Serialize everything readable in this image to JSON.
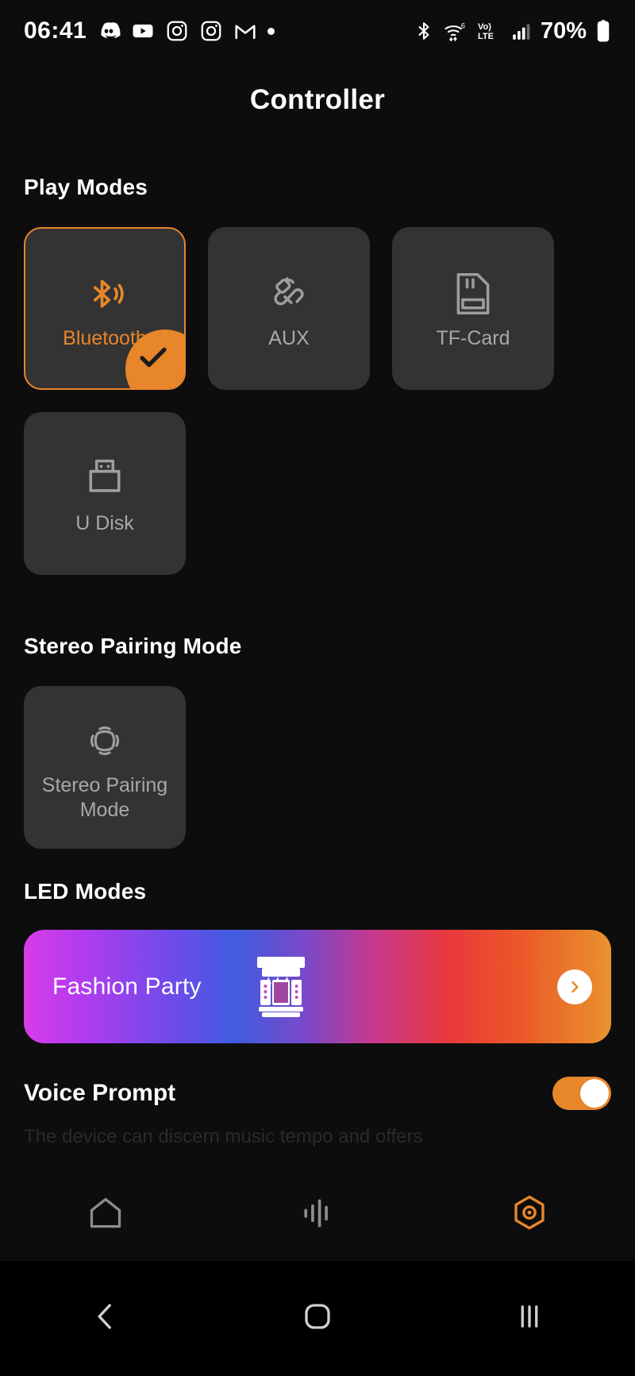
{
  "status_bar": {
    "time": "06:41",
    "left_icons": [
      "discord-icon",
      "youtube-icon",
      "instagram-icon",
      "instagram-icon",
      "gmail-icon",
      "notification-dot"
    ],
    "right_icons": [
      "bluetooth-icon",
      "wifi-6-icon",
      "volte-icon",
      "cellular-signal-icon"
    ],
    "battery_percent": "70%"
  },
  "header": {
    "title": "Controller"
  },
  "play_modes": {
    "section_label": "Play Modes",
    "cards": [
      {
        "label": "Bluetooth",
        "icon": "bluetooth-icon",
        "selected": true
      },
      {
        "label": "AUX",
        "icon": "aux-plug-icon",
        "selected": false
      },
      {
        "label": "TF-Card",
        "icon": "sd-card-icon",
        "selected": false
      },
      {
        "label": "U Disk",
        "icon": "usb-drive-icon",
        "selected": false
      }
    ],
    "selected_badge_icon": "check-icon"
  },
  "stereo_pairing": {
    "section_label": "Stereo Pairing Mode",
    "cards": [
      {
        "label": "Stereo Pairing Mode",
        "icon": "stereo-waves-icon",
        "selected": false
      }
    ]
  },
  "led_modes": {
    "section_label": "LED Modes",
    "current_mode": "Fashion Party",
    "mode_icon": "stage-lights-icon",
    "arrow_icon": "chevron-right-icon"
  },
  "voice_prompt": {
    "label": "Voice Prompt",
    "enabled": true,
    "description": "The device can discern music tempo and offers"
  },
  "tab_bar": {
    "items": [
      {
        "name": "home",
        "icon": "home-icon",
        "active": false
      },
      {
        "name": "equalizer",
        "icon": "waveform-icon",
        "active": false
      },
      {
        "name": "controller",
        "icon": "hexagon-target-icon",
        "active": true
      }
    ],
    "active_color": "#e8862a"
  },
  "android_nav": {
    "buttons": [
      {
        "name": "back",
        "icon": "back-chevron-icon"
      },
      {
        "name": "home",
        "icon": "home-square-icon"
      },
      {
        "name": "recents",
        "icon": "recents-bars-icon"
      }
    ]
  },
  "colors": {
    "accent": "#e8862a",
    "card_bg": "#333333",
    "page_bg": "#0d0d0d",
    "muted_text": "#a8a8a8"
  }
}
